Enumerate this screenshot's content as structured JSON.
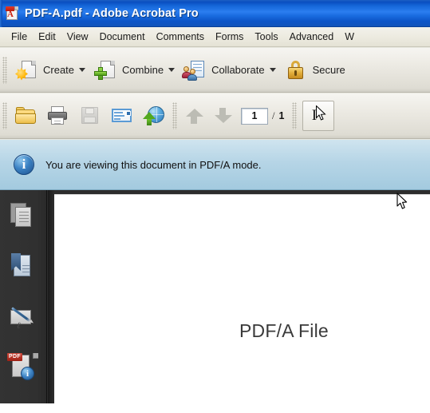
{
  "window": {
    "title": "PDF-A.pdf - Adobe Acrobat Pro",
    "app_icon": "acrobat-pdf-icon",
    "titlebar_color": "#1566d8"
  },
  "menu": {
    "items": [
      {
        "label": "File"
      },
      {
        "label": "Edit"
      },
      {
        "label": "View"
      },
      {
        "label": "Document"
      },
      {
        "label": "Comments"
      },
      {
        "label": "Forms"
      },
      {
        "label": "Tools"
      },
      {
        "label": "Advanced"
      },
      {
        "label": "W"
      }
    ]
  },
  "toolbar_main": {
    "buttons": [
      {
        "label": "Create",
        "icon": "create-pdf-icon",
        "has_dropdown": true
      },
      {
        "label": "Combine",
        "icon": "combine-files-icon",
        "has_dropdown": true
      },
      {
        "label": "Collaborate",
        "icon": "collaborate-icon",
        "has_dropdown": true
      },
      {
        "label": "Secure",
        "icon": "padlock-icon",
        "has_dropdown": false
      }
    ]
  },
  "toolbar_secondary": {
    "buttons": [
      {
        "name": "open",
        "icon": "folder-open-icon",
        "enabled": true
      },
      {
        "name": "print",
        "icon": "printer-icon",
        "enabled": true
      },
      {
        "name": "save",
        "icon": "floppy-disk-icon",
        "enabled": false
      },
      {
        "name": "email",
        "icon": "envelope-icon",
        "enabled": true
      },
      {
        "name": "upload",
        "icon": "globe-upload-icon",
        "enabled": true
      }
    ],
    "previous_page_icon": "arrow-up-icon",
    "next_page_icon": "arrow-down-icon",
    "page_number": "1",
    "page_separator": "/",
    "page_total": "1",
    "select_tool_icon": "text-select-tool-icon"
  },
  "notice": {
    "icon": "info-icon",
    "icon_glyph": "i",
    "message": "You are viewing this document in PDF/A mode.",
    "background_color": "#b6d5e6"
  },
  "nav_pane": {
    "background_color": "#303030",
    "items": [
      {
        "name": "pages",
        "icon": "page-thumbnails-icon"
      },
      {
        "name": "bookmarks",
        "icon": "bookmark-icon"
      },
      {
        "name": "signatures",
        "icon": "signature-pen-icon"
      },
      {
        "name": "standards",
        "icon": "pdf-standards-info-icon",
        "tag": "PDF",
        "badge_glyph": "i"
      }
    ]
  },
  "document": {
    "page_text": "PDF/A File",
    "page_background": "#ffffff",
    "viewport_background": "#2d2d2d",
    "cursor": "arrow-cursor"
  }
}
